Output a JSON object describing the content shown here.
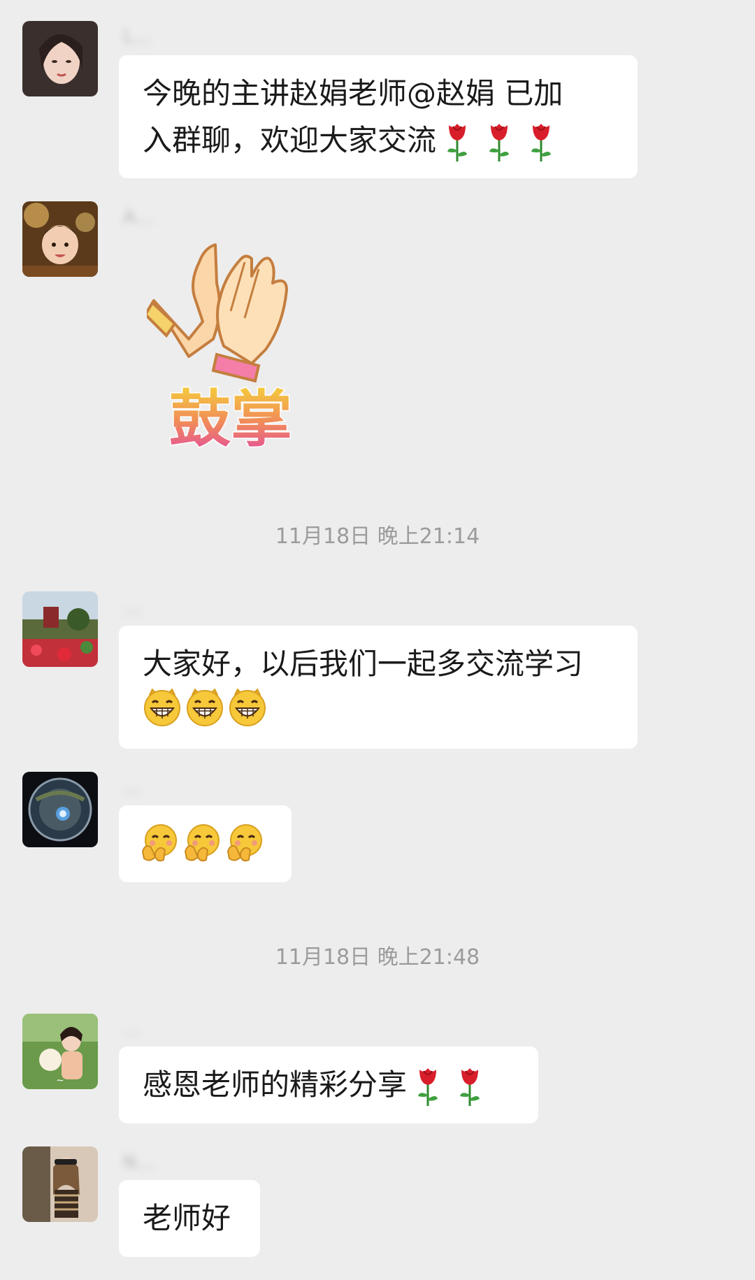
{
  "messages": [
    {
      "sender": "L…",
      "text_line1": "今晚的主讲赵娟老师@赵娟  已加",
      "text_line2": "入群聊，欢迎大家交流"
    },
    {
      "sender": "A…",
      "sticker_text": "鼓掌"
    },
    {
      "sender": "…",
      "text_line1": "大家好，以后我们一起多交流学习"
    },
    {
      "sender": "…"
    },
    {
      "sender": "…",
      "text_line1": "感恩老师的精彩分享"
    },
    {
      "sender": "N…",
      "text_line1": "老师好"
    }
  ],
  "timestamps": [
    "11月18日 晚上21:14",
    "11月18日 晚上21:48"
  ],
  "icons": [
    "rose-icon",
    "grin-emoji",
    "hug-emoji",
    "clap-sticker"
  ],
  "colors": {
    "background": "#ededed",
    "bubble": "#ffffff",
    "timestamp": "#9b9b9b"
  }
}
